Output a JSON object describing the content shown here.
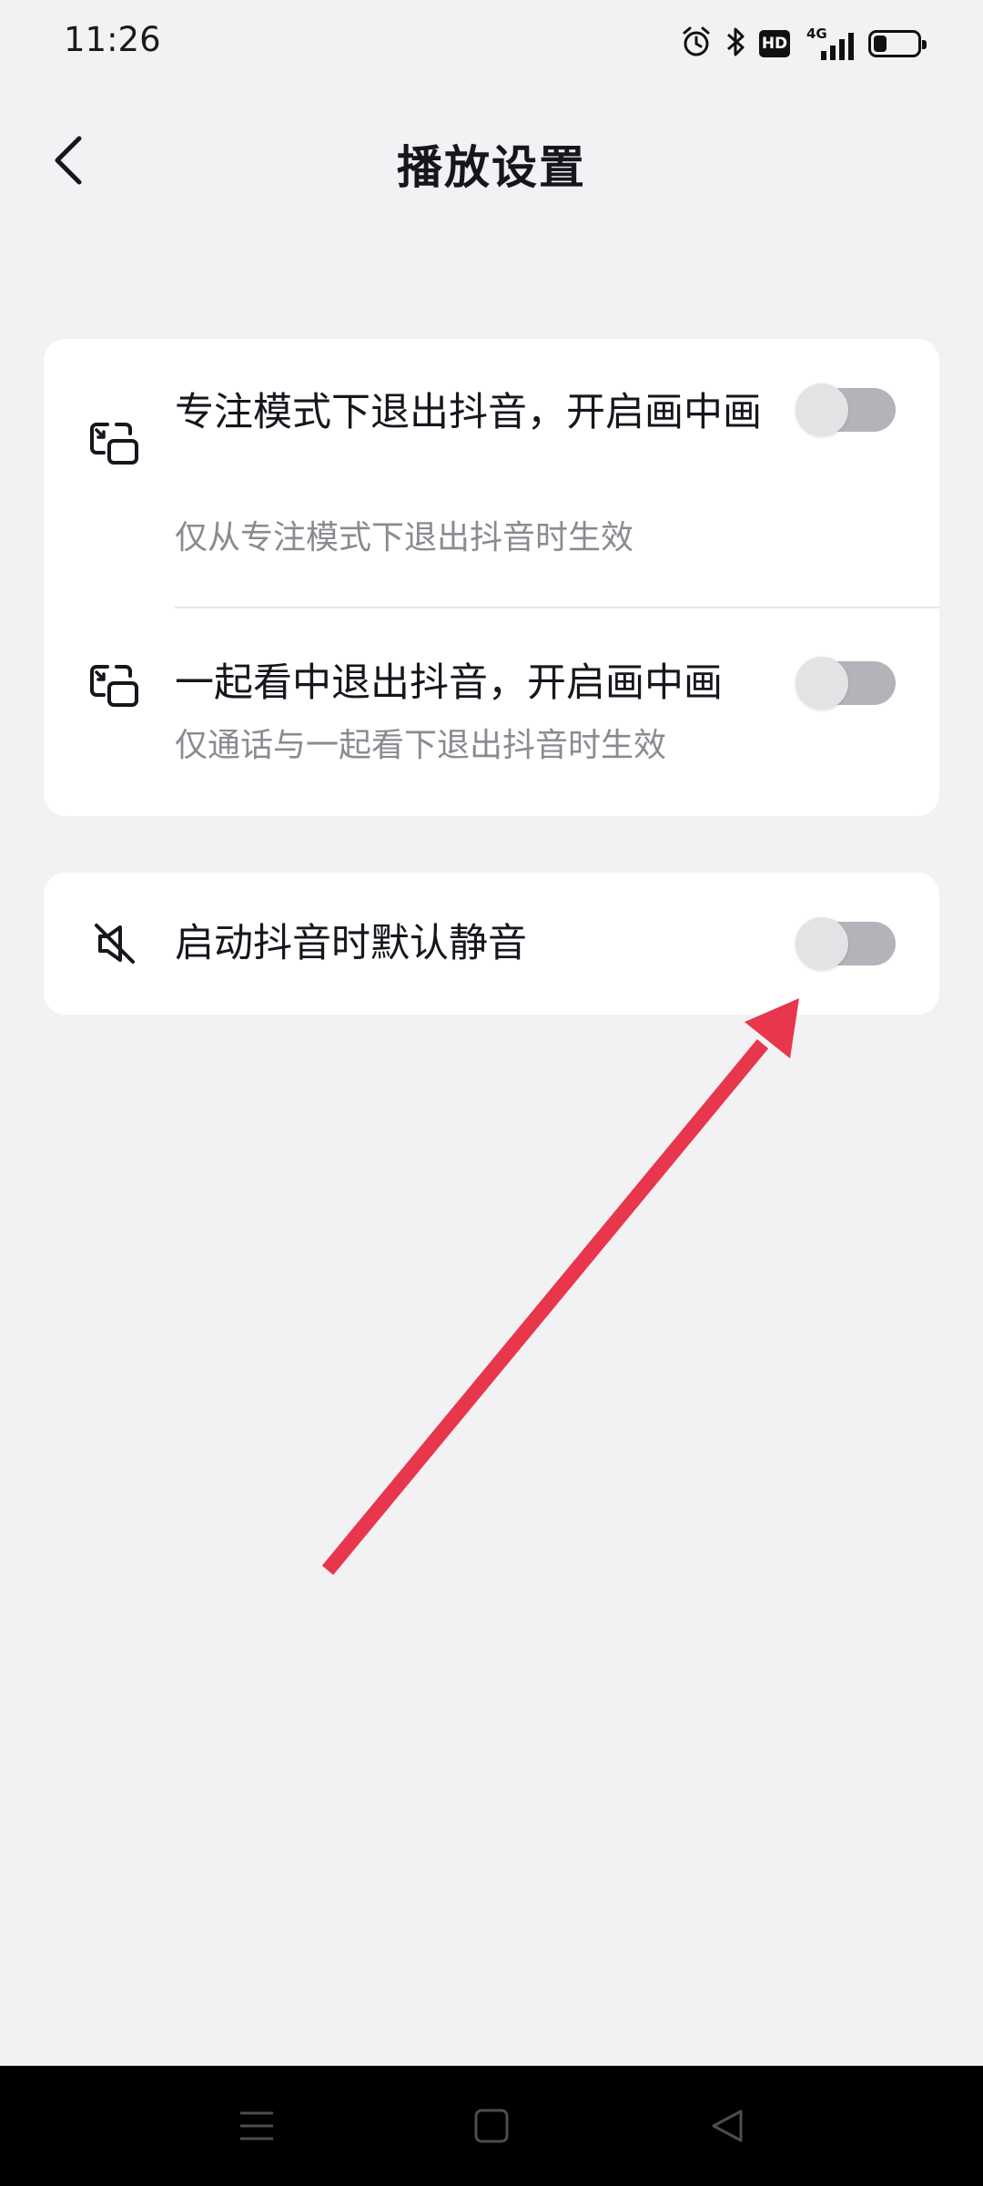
{
  "status_bar": {
    "time": "11:26",
    "icons": [
      "alarm-icon",
      "bluetooth-icon",
      "hd-icon",
      "signal-4g-icon",
      "battery-icon"
    ],
    "hd_label": "HD",
    "network_label": "4G"
  },
  "header": {
    "title": "播放设置",
    "back_icon": "chevron-left-icon"
  },
  "settings": {
    "group1": [
      {
        "icon": "picture-in-picture-icon",
        "title": "专注模式下退出抖音，开启画中画",
        "subtitle": "仅从专注模式下退出抖音时生效",
        "enabled": false
      },
      {
        "icon": "picture-in-picture-icon",
        "title": "一起看中退出抖音，开启画中画",
        "subtitle": "仅通话与一起看下退出抖音时生效",
        "enabled": false
      }
    ],
    "group2": [
      {
        "icon": "mute-icon",
        "title": "启动抖音时默认静音",
        "enabled": false
      }
    ]
  },
  "colors": {
    "background": "#f2f1f3",
    "card": "#ffffff",
    "toggle_off_track": "#b3b3b9",
    "toggle_knob": "#e3e3e6",
    "annotation_arrow": "#e8364d",
    "nav_bar": "#000000"
  },
  "nav_bar": {
    "buttons": [
      "menu-icon",
      "home-icon",
      "back-triangle-icon"
    ]
  }
}
